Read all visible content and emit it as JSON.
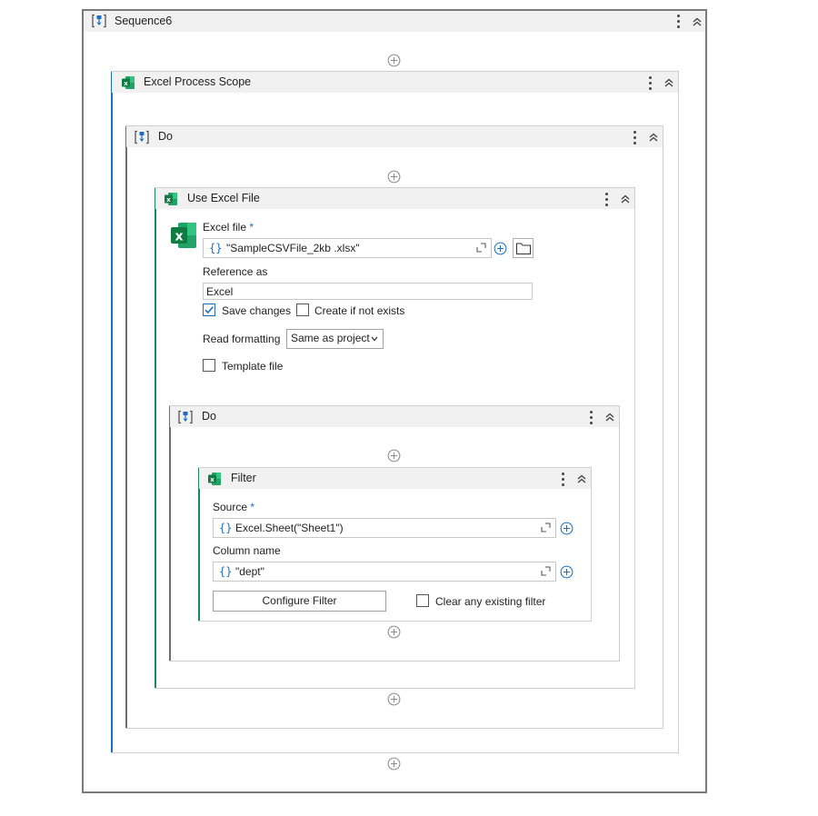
{
  "sequence": {
    "title": "Sequence6"
  },
  "excel_scope": {
    "title": "Excel Process Scope"
  },
  "do1": {
    "title": "Do"
  },
  "use_excel": {
    "title": "Use Excel File",
    "excel_file_label": "Excel file",
    "required_mark": "*",
    "excel_file_value": "\"SampleCSVFile_2kb .xlsx\"",
    "brace": "{}",
    "reference_label": "Reference as",
    "reference_value": "Excel",
    "save_changes_label": "Save changes",
    "save_changes_checked": true,
    "create_if_not_exists_label": "Create if not exists",
    "create_if_not_exists_checked": false,
    "read_formatting_label": "Read formatting",
    "read_formatting_value": "Same as project",
    "template_file_label": "Template file",
    "template_file_checked": false
  },
  "do2": {
    "title": "Do"
  },
  "filter": {
    "title": "Filter",
    "source_label": "Source",
    "required_mark": "*",
    "source_value": "Excel.Sheet(\"Sheet1\")",
    "brace": "{}",
    "column_label": "Column name",
    "column_value": "\"dept\"",
    "configure_button": "Configure Filter",
    "clear_filter_label": "Clear any existing filter",
    "clear_filter_checked": false
  },
  "icons": {
    "sequence": "sequence-icon",
    "excel": "excel-icon",
    "add": "add-activity-icon",
    "kebab": "more-options-icon",
    "collapse": "collapse-icon",
    "expand": "expand-editor-icon",
    "folder": "folder-icon",
    "checkmark": "checkmark-icon",
    "chevron_down": "chevron-down-icon"
  },
  "colors": {
    "accent_blue": "#1b6ec2",
    "excel_green": "#1a8a5a",
    "header_bg": "#f1f1f1"
  }
}
